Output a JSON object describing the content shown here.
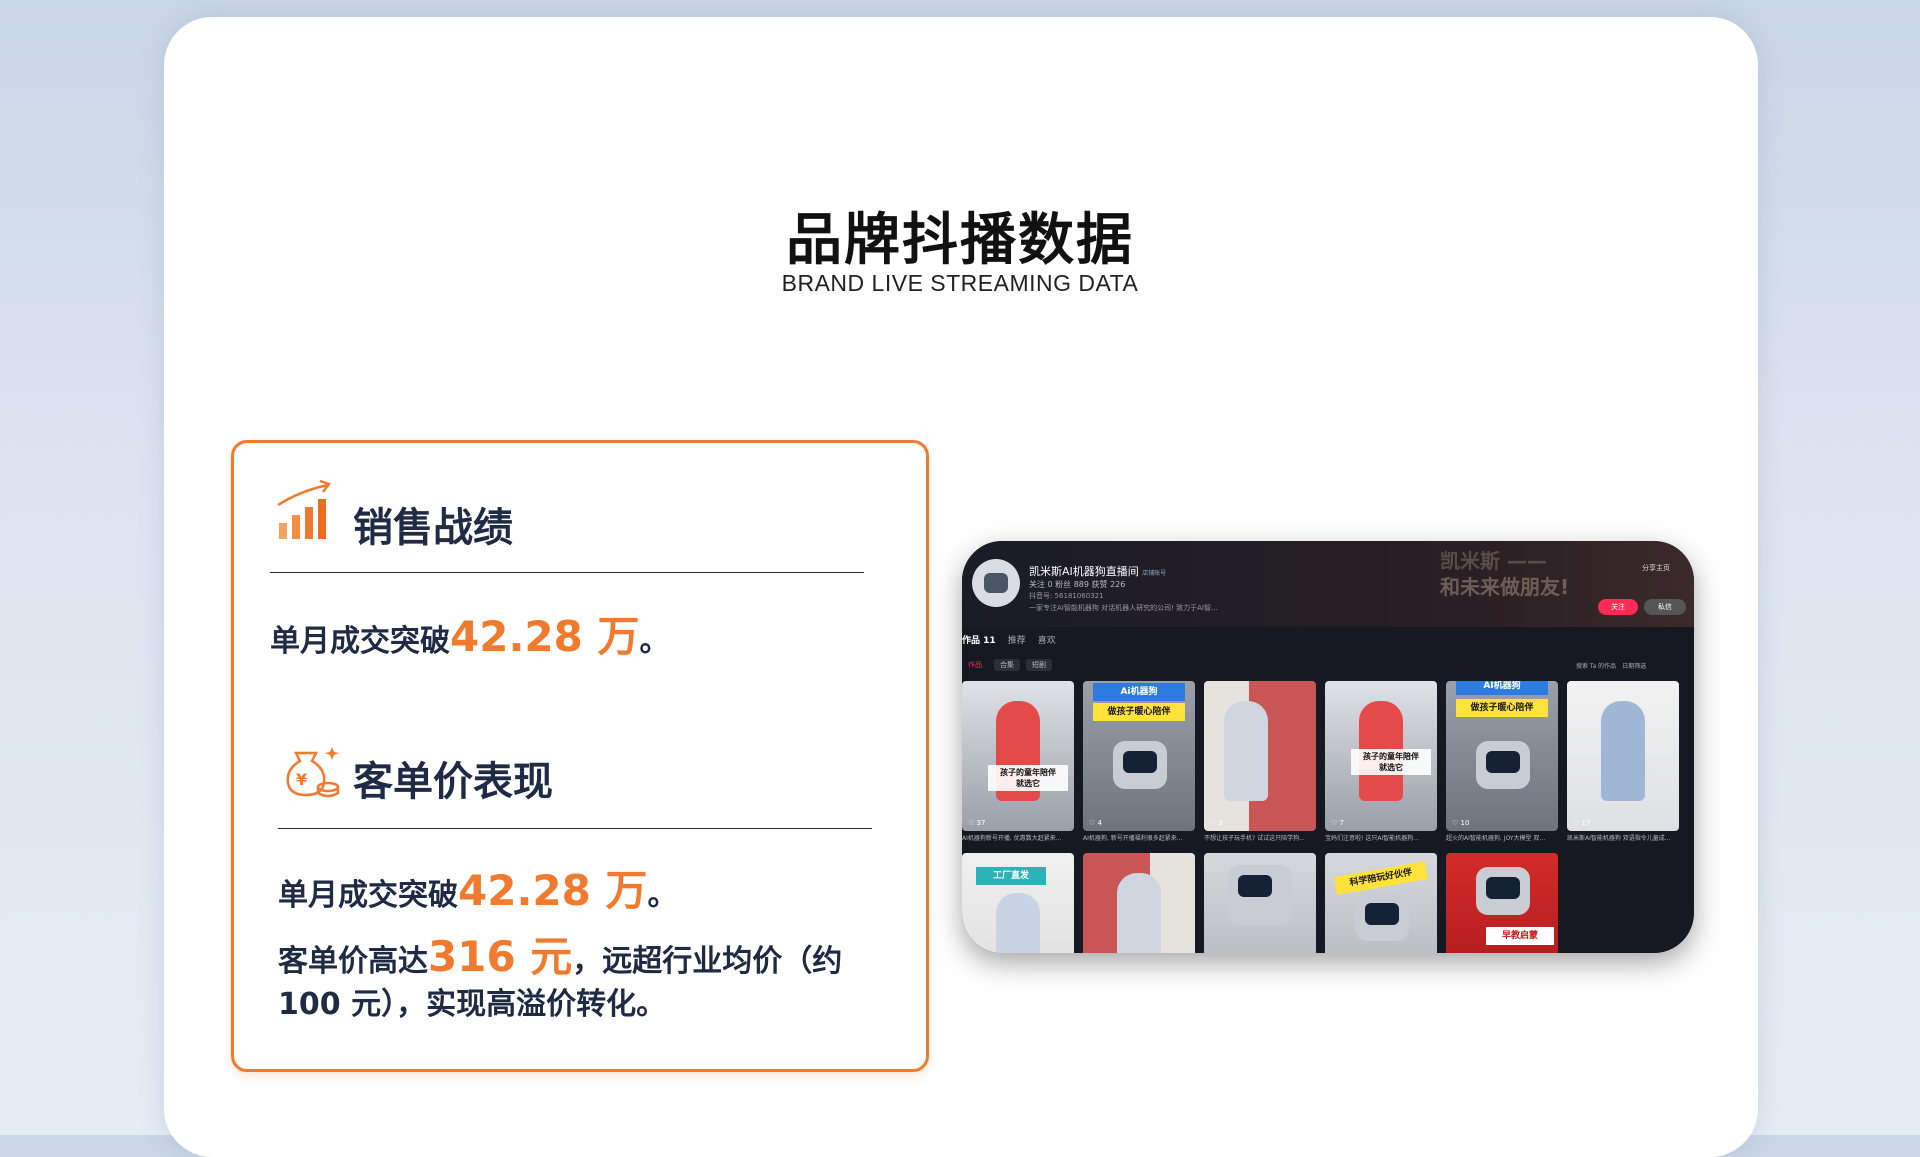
{
  "header": {
    "title": "品牌抖播数据",
    "subtitle": "BRAND LIVE STREAMING DATA"
  },
  "sales": {
    "title": "销售战绩",
    "line1_prefix": "单月成交突破",
    "line1_value": "42.28 万",
    "line1_suffix": "。"
  },
  "aov": {
    "title": "客单价表现",
    "line1_prefix": "单月成交突破",
    "line1_value": "42.28 万",
    "line1_suffix": "。",
    "line2_prefix": "客单价高达",
    "line2_value": "316 元",
    "line2_suffix": "，远超行业均价（约",
    "line3": " 100 元），实现高溢价转化。"
  },
  "colors": {
    "accent": "#f07a2e",
    "text": "#1f2a44",
    "follow": "#fe2c55"
  },
  "icons": {
    "sales": "bar-chart-up-icon",
    "aov": "money-bag-coins-icon"
  },
  "screenshot": {
    "account_name": "凯米斯AI机器狗直播间",
    "badge": "店铺账号",
    "stats": "关注 0    粉丝 889    获赞 226",
    "id_line": "抖音号: 56181060321",
    "desc": "一家专注AI智能机器狗 对话机器人研究的公司! 致力于AI智...",
    "slogan1": "凯米斯 ——",
    "slogan2": "和未来做朋友!",
    "share": "分享主页",
    "follow": "关注",
    "message": "私信",
    "tabs": [
      "作品 11",
      "推荐",
      "喜欢"
    ],
    "subtabs": [
      "作品",
      "合集",
      "短剧"
    ],
    "search": "搜索 Ta 的作品",
    "filter": "日期筛选",
    "row1": [
      {
        "caption": "孩子的童年陪伴\n就选它",
        "likes": "37",
        "title": "AI机器狗新号开播, 优惠数大赶紧来..."
      },
      {
        "tag": "Ai机器狗",
        "tag2": "做孩子暖心陪伴",
        "likes": "4",
        "title": "AI机器狗, 新号开播福利很多赶紧来..."
      },
      {
        "likes": "3",
        "title": "不想让孩子玩手机? 试试这只陪学狗..."
      },
      {
        "caption": "孩子的童年陪伴\n就选它",
        "likes": "7",
        "title": "宝妈们注意啦! 这只AI智能机器狗..."
      },
      {
        "tag": "AI机器狗",
        "tag2": "做孩子暖心陪伴",
        "likes": "10",
        "title": "超火的AI智能机器狗, JOY大模型 双..."
      },
      {
        "likes": "17",
        "title": "凯米斯AI智能机器狗 双语指令儿童成..."
      }
    ],
    "row2": [
      {
        "tag": "工厂直发"
      },
      {},
      {},
      {
        "tag": "科学陪玩好伙伴"
      },
      {
        "tag": "早教启蒙"
      }
    ]
  }
}
